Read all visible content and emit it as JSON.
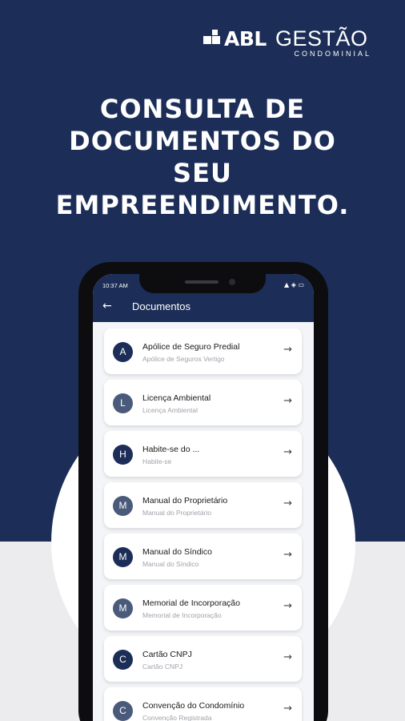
{
  "brand": {
    "name": "ABL",
    "name2": "GESTÃO",
    "tagline": "CONDOMINIAL"
  },
  "headline": {
    "line1": "CONSULTA DE",
    "line2": "DOCUMENTOS DO",
    "line3": "SEU",
    "line4": "EMPREENDIMENTO."
  },
  "phone": {
    "status": {
      "time": "10:37 AM",
      "icons": "▲ ◈ ▭"
    },
    "appbar": {
      "back_icon": "←",
      "title": "Documentos"
    },
    "documents": [
      {
        "letter": "A",
        "title": "Apólice de Seguro Predial",
        "subtitle": "Apólice de Seguros Vertigo"
      },
      {
        "letter": "L",
        "title": "Licença Ambiental",
        "subtitle": "Licença Ambiental"
      },
      {
        "letter": "H",
        "title": "Habite-se do ...",
        "subtitle": "Habite-se"
      },
      {
        "letter": "M",
        "title": "Manual do Proprietário",
        "subtitle": "Manual do Proprietário"
      },
      {
        "letter": "M",
        "title": "Manual do Síndico",
        "subtitle": "Manual do Síndico"
      },
      {
        "letter": "M",
        "title": "Memorial de Incorporação",
        "subtitle": "Memorial de Incorporação"
      },
      {
        "letter": "C",
        "title": "Cartão CNPJ",
        "subtitle": "Cartão CNPJ"
      },
      {
        "letter": "C",
        "title": "Convenção do Condomínio",
        "subtitle": "Convenção Registrada"
      }
    ],
    "chevron_icon": "→"
  },
  "colors": {
    "navy": "#1c2e57",
    "light_bg": "#ececee",
    "avatar_light": "#4a5a7a"
  }
}
